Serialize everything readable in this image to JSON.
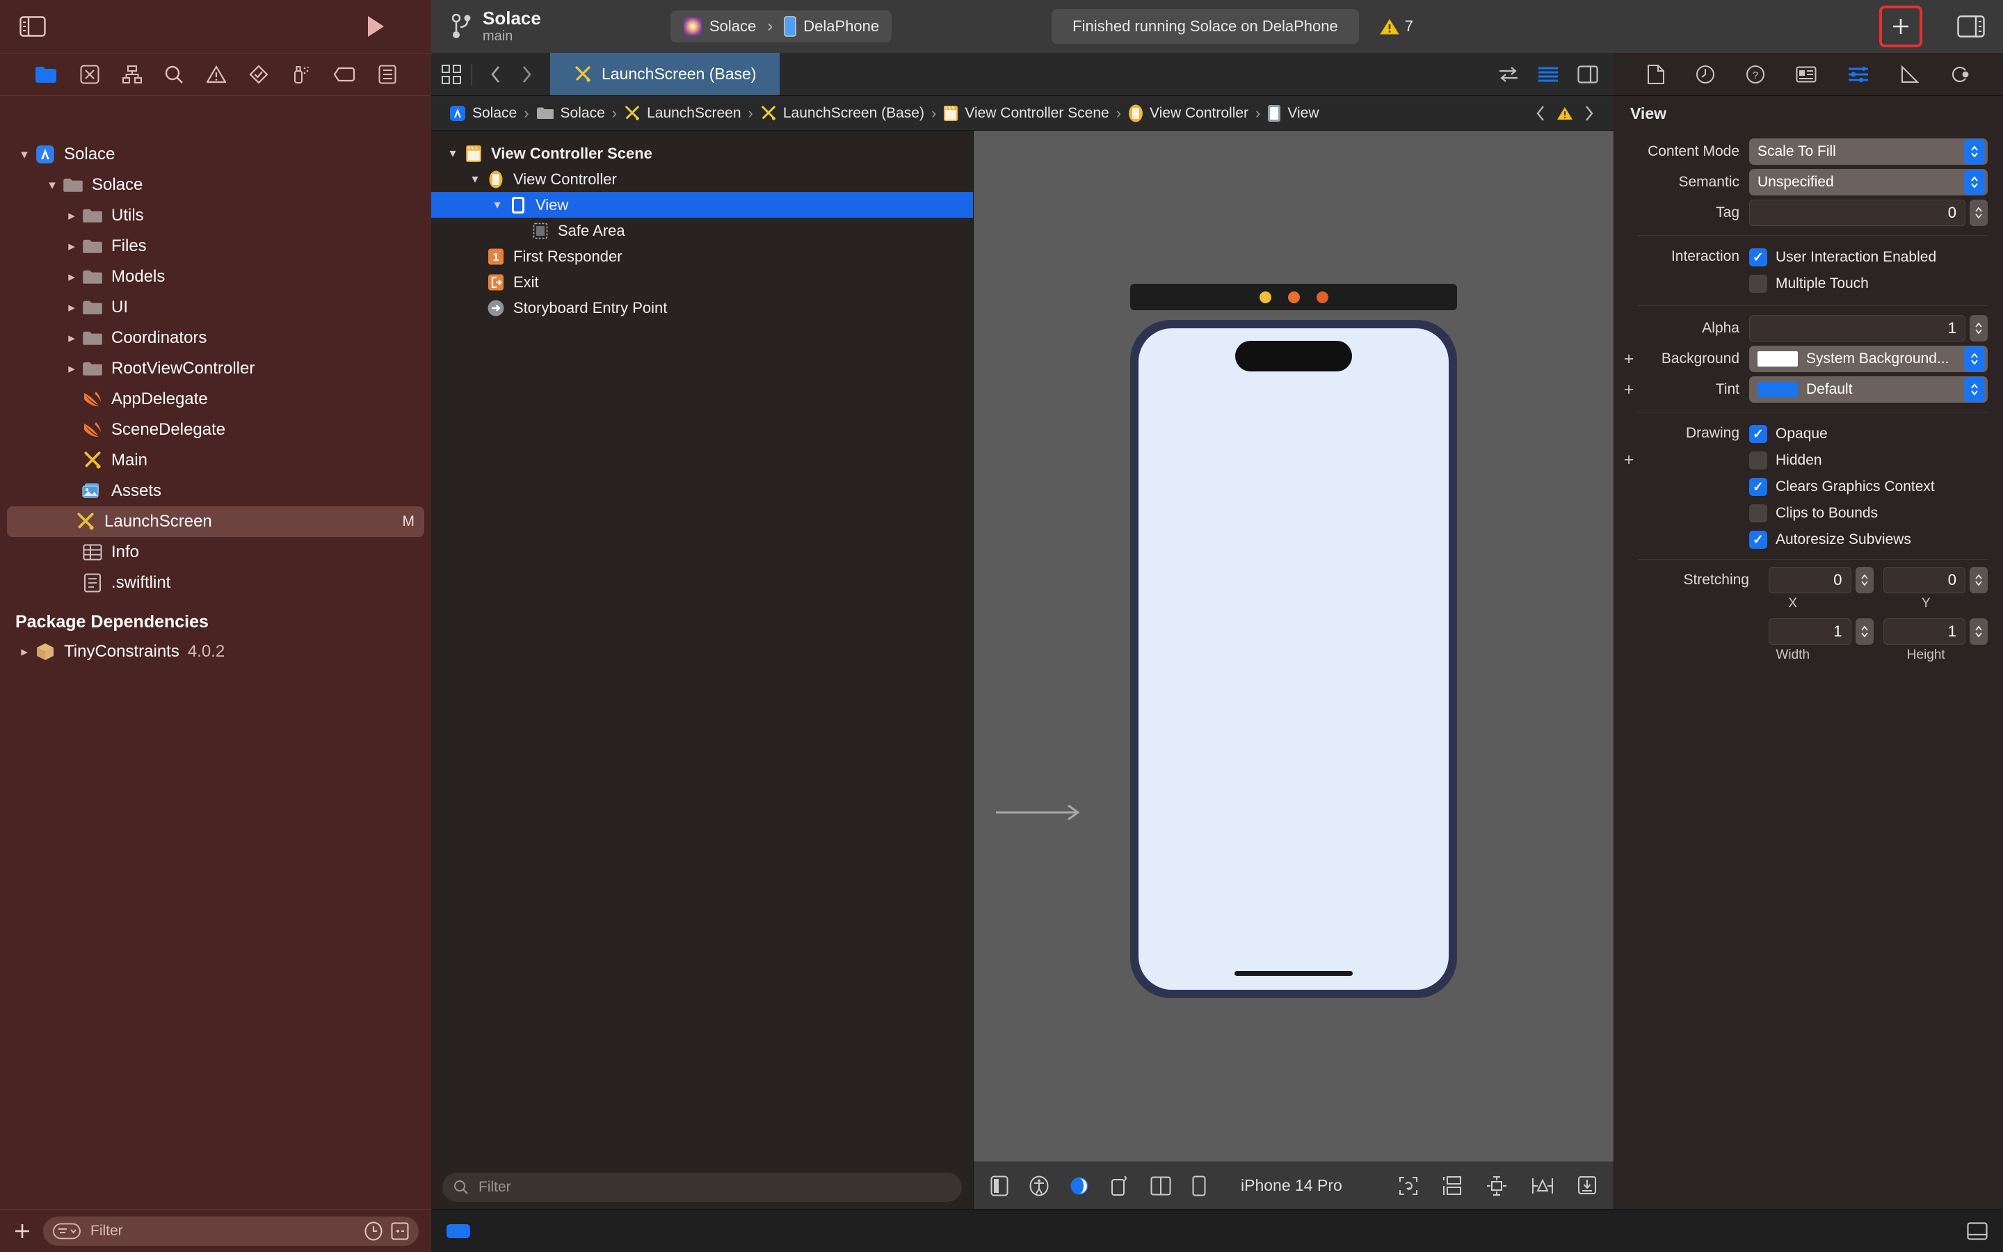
{
  "toolbar": {
    "branch_name": "Solace",
    "branch_sub": "main",
    "scheme_name": "Solace",
    "device_name": "DelaPhone",
    "status_text": "Finished running Solace on DelaPhone",
    "warning_count": "7",
    "sidebar_toggle_icon": "sidebar-left-icon",
    "run_icon": "play-icon",
    "add_icon": "plus-icon",
    "right_panel_icon": "sidebar-right-icon",
    "branch_icon": "git-branch-icon",
    "warning_icon": "warning-triangle-icon",
    "accent_red": "#e63030"
  },
  "navigator": {
    "icons": [
      {
        "name": "folder-icon",
        "label": "Project navigator",
        "active": true
      },
      {
        "name": "source-control-icon",
        "label": "Source control navigator",
        "active": false
      },
      {
        "name": "hierarchy-icon",
        "label": "Symbol navigator",
        "active": false
      },
      {
        "name": "search-icon",
        "label": "Find navigator",
        "active": false
      },
      {
        "name": "warning-triangle-icon",
        "label": "Issue navigator",
        "active": false
      },
      {
        "name": "test-diamond-icon",
        "label": "Test navigator",
        "active": false
      },
      {
        "name": "debug-spray-icon",
        "label": "Debug navigator",
        "active": false
      },
      {
        "name": "breakpoint-tag-icon",
        "label": "Breakpoint navigator",
        "active": false
      },
      {
        "name": "report-list-icon",
        "label": "Report navigator",
        "active": false
      }
    ],
    "tree": [
      {
        "label": "Solace",
        "indent": 0,
        "twisty": "down",
        "icon": "app-project-icon",
        "badge": ""
      },
      {
        "label": "Solace",
        "indent": 1,
        "twisty": "down",
        "icon": "folder-icon",
        "badge": ""
      },
      {
        "label": "Utils",
        "indent": 2,
        "twisty": "right",
        "icon": "folder-icon",
        "badge": ""
      },
      {
        "label": "Files",
        "indent": 2,
        "twisty": "right",
        "icon": "folder-icon",
        "badge": ""
      },
      {
        "label": "Models",
        "indent": 2,
        "twisty": "right",
        "icon": "folder-icon",
        "badge": ""
      },
      {
        "label": "UI",
        "indent": 2,
        "twisty": "right",
        "icon": "folder-icon",
        "badge": ""
      },
      {
        "label": "Coordinators",
        "indent": 2,
        "twisty": "right",
        "icon": "folder-icon",
        "badge": ""
      },
      {
        "label": "RootViewController",
        "indent": 2,
        "twisty": "right",
        "icon": "folder-icon",
        "badge": ""
      },
      {
        "label": "AppDelegate",
        "indent": 2,
        "twisty": "none",
        "icon": "swift-icon",
        "badge": ""
      },
      {
        "label": "SceneDelegate",
        "indent": 2,
        "twisty": "none",
        "icon": "swift-icon",
        "badge": ""
      },
      {
        "label": "Main",
        "indent": 2,
        "twisty": "none",
        "icon": "storyboard-icon",
        "badge": ""
      },
      {
        "label": "Assets",
        "indent": 2,
        "twisty": "none",
        "icon": "assets-icon",
        "badge": ""
      },
      {
        "label": "LaunchScreen",
        "indent": 2,
        "twisty": "none",
        "icon": "storyboard-icon",
        "badge": "M",
        "selected": true
      },
      {
        "label": "Info",
        "indent": 2,
        "twisty": "none",
        "icon": "plist-icon",
        "badge": ""
      },
      {
        "label": ".swiftlint",
        "indent": 2,
        "twisty": "none",
        "icon": "config-file-icon",
        "badge": ""
      }
    ],
    "packages_header": "Package Dependencies",
    "packages": [
      {
        "label": "TinyConstraints",
        "version": "4.0.2",
        "icon": "package-box-icon"
      }
    ],
    "filter_placeholder": "Filter",
    "filter_icon": "filter-icon",
    "add_icon": "plus-icon",
    "recent_icon": "clock-icon",
    "source-control_icon": "sourcecontrol-filter-icon"
  },
  "tabbar": {
    "grid_icon": "tab-grid-icon",
    "back_icon": "chevron-left-icon",
    "forward_icon": "chevron-right-icon",
    "active_tab": "LaunchScreen (Base)",
    "active_tab_icon": "storyboard-icon",
    "trailing_icons": [
      {
        "name": "compare-versions-icon"
      },
      {
        "name": "editor-options-icon",
        "active": true
      },
      {
        "name": "add-editor-icon"
      }
    ]
  },
  "breadcrumb": {
    "items": [
      {
        "label": "Solace",
        "icon": "app-project-icon"
      },
      {
        "label": "Solace",
        "icon": "folder-icon"
      },
      {
        "label": "LaunchScreen",
        "icon": "storyboard-icon"
      },
      {
        "label": "LaunchScreen (Base)",
        "icon": "storyboard-icon"
      },
      {
        "label": "View Controller Scene",
        "icon": "scene-icon"
      },
      {
        "label": "View Controller",
        "icon": "viewcontroller-icon"
      },
      {
        "label": "View",
        "icon": "view-icon"
      }
    ],
    "separator": "›",
    "trailing": [
      {
        "name": "chevron-left-icon"
      },
      {
        "name": "warning-triangle-icon"
      },
      {
        "name": "chevron-right-icon"
      }
    ]
  },
  "outline": {
    "rows": [
      {
        "label": "View Controller Scene",
        "indent": 0,
        "twisty": "down",
        "icon": "scene-icon",
        "bold": true,
        "selected": false
      },
      {
        "label": "View Controller",
        "indent": 1,
        "twisty": "down",
        "icon": "viewcontroller-icon",
        "bold": false,
        "selected": false
      },
      {
        "label": "View",
        "indent": 2,
        "twisty": "down",
        "icon": "view-icon",
        "bold": false,
        "selected": true
      },
      {
        "label": "Safe Area",
        "indent": 3,
        "twisty": "none",
        "icon": "safearea-icon",
        "bold": false,
        "selected": false
      },
      {
        "label": "First Responder",
        "indent": 1,
        "twisty": "none",
        "icon": "first-responder-icon",
        "bold": false,
        "selected": false
      },
      {
        "label": "Exit",
        "indent": 1,
        "twisty": "none",
        "icon": "exit-icon",
        "bold": false,
        "selected": false
      },
      {
        "label": "Storyboard Entry Point",
        "indent": 1,
        "twisty": "none",
        "icon": "entry-point-icon",
        "bold": false,
        "selected": false
      }
    ],
    "filter_placeholder": "Filter",
    "filter_icon": "filter-icon"
  },
  "canvas": {
    "device_name": "iPhone 14 Pro",
    "title_dots": [
      "#f0bd3a",
      "#e8702a",
      "#e05f2a"
    ],
    "screen_color": "#e3ecfb",
    "bottom_icons": [
      {
        "name": "device-bezel-icon",
        "active": false
      },
      {
        "name": "accessibility-icon",
        "active": false
      },
      {
        "name": "appearance-icon",
        "active": true
      },
      {
        "name": "orientation-icon",
        "active": false
      },
      {
        "name": "split-view-icon",
        "active": false
      },
      {
        "name": "device-size-icon",
        "active": false
      }
    ],
    "bottom_trailing_icons": [
      {
        "name": "update-frames-icon"
      },
      {
        "name": "embed-in-icon"
      },
      {
        "name": "align-icon"
      },
      {
        "name": "add-constraints-icon"
      },
      {
        "name": "resolve-issues-icon"
      }
    ]
  },
  "inspector": {
    "tabs": [
      {
        "name": "file-inspector-icon",
        "active": false
      },
      {
        "name": "history-inspector-icon",
        "active": false
      },
      {
        "name": "quick-help-icon",
        "active": false
      },
      {
        "name": "identity-inspector-icon",
        "active": false
      },
      {
        "name": "attributes-inspector-icon",
        "active": true
      },
      {
        "name": "size-inspector-icon",
        "active": false
      },
      {
        "name": "connections-inspector-icon",
        "active": false
      }
    ],
    "title": "View",
    "content_mode": {
      "label": "Content Mode",
      "value": "Scale To Fill"
    },
    "semantic": {
      "label": "Semantic",
      "value": "Unspecified"
    },
    "tag": {
      "label": "Tag",
      "value": "0"
    },
    "interaction": {
      "label": "Interaction",
      "items": [
        {
          "label": "User Interaction Enabled",
          "checked": true
        },
        {
          "label": "Multiple Touch",
          "checked": false
        }
      ]
    },
    "alpha": {
      "label": "Alpha",
      "value": "1"
    },
    "background": {
      "label": "Background",
      "value": "System Background...",
      "swatch": "#ffffff"
    },
    "tint": {
      "label": "Tint",
      "value": "Default",
      "swatch": "#1a74f0"
    },
    "drawing": {
      "label": "Drawing",
      "items": [
        {
          "label": "Opaque",
          "checked": true
        },
        {
          "label": "Hidden",
          "checked": false
        },
        {
          "label": "Clears Graphics Context",
          "checked": true
        },
        {
          "label": "Clips to Bounds",
          "checked": false
        },
        {
          "label": "Autoresize Subviews",
          "checked": true
        }
      ]
    },
    "stretching": {
      "label": "Stretching",
      "x": {
        "caption": "X",
        "value": "0"
      },
      "y": {
        "caption": "Y",
        "value": "0"
      },
      "width": {
        "caption": "Width",
        "value": "1"
      },
      "height": {
        "caption": "Height",
        "value": "1"
      }
    }
  },
  "statusbar": {
    "add_icon": "plus-icon",
    "filter_placeholder": "Filter",
    "filter_icon": "filter-icon",
    "clock_icon": "clock-icon",
    "toggle_icon": "add-remove-icon",
    "panel_icon": "bottom-panel-icon"
  }
}
